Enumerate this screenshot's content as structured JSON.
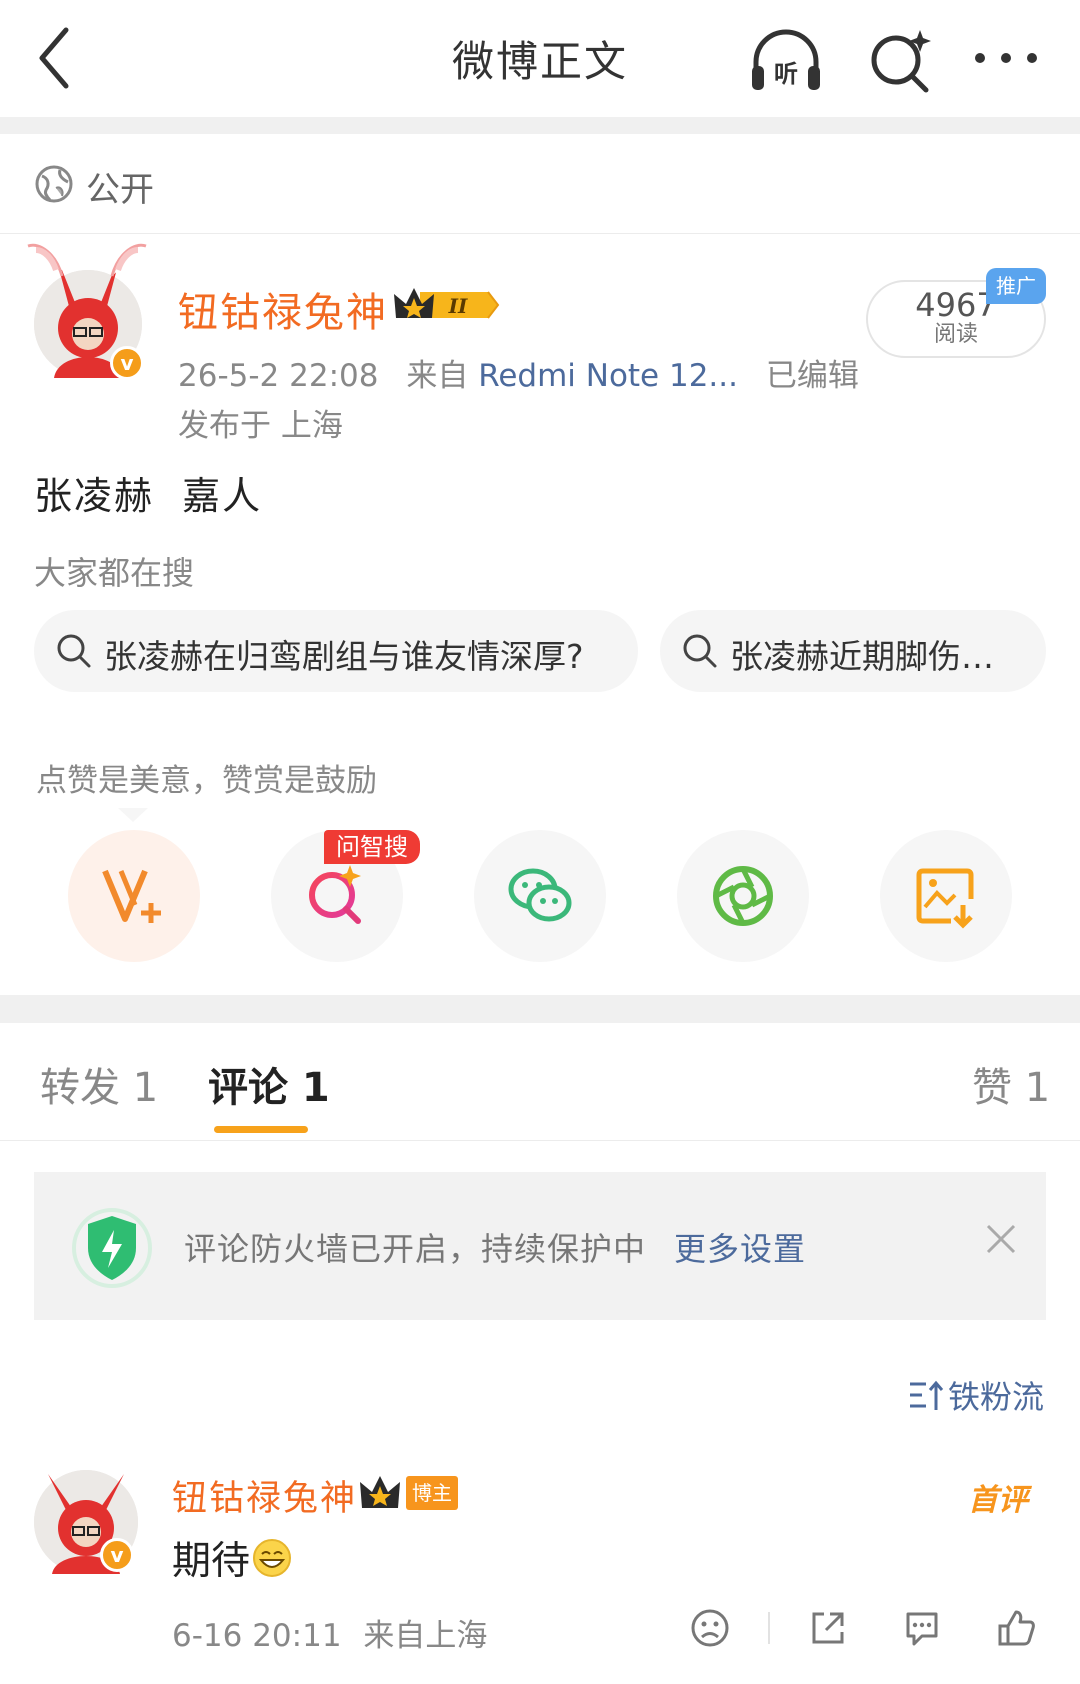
{
  "header": {
    "title": "微博正文"
  },
  "visibility": {
    "label": "公开"
  },
  "post": {
    "author": "钮钴禄兔神",
    "level": "II",
    "time": "26-5-2 22:08",
    "source_prefix": "来自",
    "device": "Redmi Note 12...",
    "edited": "已编辑",
    "location": "发布于 上海",
    "reads_count": "4967",
    "reads_label": "阅读",
    "promo_label": "推广",
    "content": "张凌赫  嘉人"
  },
  "search": {
    "header": "大家都在搜",
    "items": [
      "张凌赫在归鸾剧组与谁友情深厚?",
      "张凌赫近期脚伤…"
    ]
  },
  "actions": {
    "hint": "点赞是美意，赞赏是鼓励",
    "ai_badge": "问智搜"
  },
  "tabs": [
    {
      "label": "转发 1"
    },
    {
      "label": "评论 1"
    },
    {
      "label": "赞 1"
    }
  ],
  "firewall": {
    "text": "评论防火墙已开启，持续保护中",
    "link": "更多设置"
  },
  "sort": {
    "label": "铁粉流"
  },
  "comment": {
    "author": "钮钴禄兔神",
    "badge": "博主",
    "first_label": "首评",
    "text": "期待",
    "time": "6-16 20:11",
    "location": "来自上海"
  }
}
